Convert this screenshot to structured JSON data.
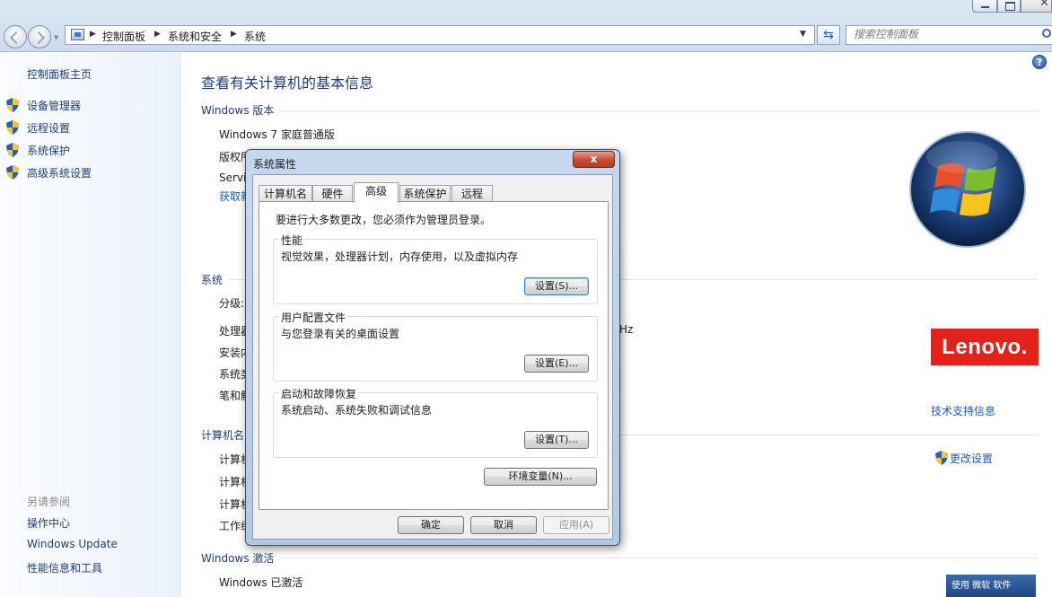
{
  "breadcrumb": [
    "控制面板",
    "系统和安全",
    "系统"
  ],
  "search": {
    "placeholder": "搜索控制面板"
  },
  "sidebar": {
    "home": "控制面板主页",
    "items": [
      {
        "label": "设备管理器",
        "icon": "uac-shield-icon"
      },
      {
        "label": "远程设置",
        "icon": "uac-shield-icon"
      },
      {
        "label": "系统保护",
        "icon": "uac-shield-icon"
      },
      {
        "label": "高级系统设置",
        "icon": "uac-shield-icon"
      }
    ],
    "see_also_title": "另请参阅",
    "see_also": [
      "操作中心",
      "Windows Update",
      "性能信息和工具"
    ]
  },
  "main": {
    "title": "查看有关计算机的基本信息",
    "windows_edition": {
      "heading": "Windows 版本",
      "edition": "Windows 7 家庭普通版",
      "copyright_partial": "版权所",
      "service_partial": "Servi",
      "get_more_partial": "获取新"
    },
    "system": {
      "heading": "系统",
      "rows": [
        "分级:",
        "处理器",
        "安装内",
        "系统类",
        "笔和触"
      ],
      "processor_suffix": "Hz"
    },
    "computer_name": {
      "heading": "计算机名",
      "rows": [
        "计算机",
        "计算机",
        "计算机",
        "工作组"
      ]
    },
    "activation": {
      "heading": "Windows 激活",
      "status": "Windows 已激活"
    },
    "oem_logo": "Lenovo.",
    "support_link": "技术支持信息",
    "change_settings": "更改设置",
    "genuine_badge": "使用 微软 软件"
  },
  "dialog": {
    "title": "系统属性",
    "close_glyph": "x",
    "tabs": [
      "计算机名",
      "硬件",
      "高级",
      "系统保护",
      "远程"
    ],
    "active_tab": "高级",
    "admin_note": "要进行大多数更改，您必须作为管理员登录。",
    "groups": [
      {
        "title": "性能",
        "desc": "视觉效果，处理器计划，内存使用，以及虚拟内存",
        "button": "设置(S)..."
      },
      {
        "title": "用户配置文件",
        "desc": "与您登录有关的桌面设置",
        "button": "设置(E)..."
      },
      {
        "title": "启动和故障恢复",
        "desc": "系统启动、系统失败和调试信息",
        "button": "设置(T)..."
      }
    ],
    "env_button": "环境变量(N)...",
    "ok": "确定",
    "cancel": "取消",
    "apply": "应用(A)"
  },
  "colors": {
    "link": "#1a5ec1",
    "heading": "#1e3c78",
    "lenovo_red": "#e2231a",
    "close_red": "#c74b35"
  }
}
